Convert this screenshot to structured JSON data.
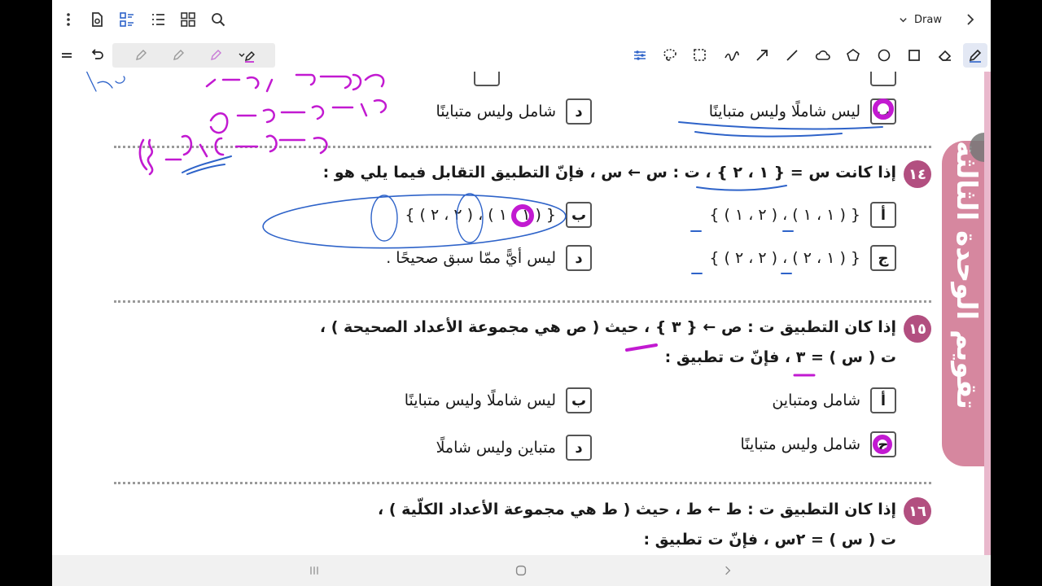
{
  "toolbar_top": {
    "mode_label": "Draw",
    "icons": [
      "more-vert-icon",
      "page-settings-icon",
      "layout-icon",
      "list-icon",
      "grid-icon",
      "search-icon",
      "chevron-down-icon",
      "chevron-right-icon"
    ]
  },
  "toolbar_draw": {
    "tools": [
      "menu-icon",
      "undo-icon",
      "pen-icon",
      "pen-icon",
      "highlighter-icon",
      "pen-active-icon",
      "settings-sliders-icon",
      "lasso-icon",
      "select-rect-icon",
      "scribble-icon",
      "arrow-icon",
      "line-icon",
      "cloud-icon",
      "pentagon-icon",
      "circle-icon",
      "square-icon",
      "eraser-icon",
      "pencil-selected-icon"
    ]
  },
  "doc": {
    "q13": {
      "opt_right": {
        "letter": "د",
        "text": "شامل وليس متباينًا"
      },
      "opt_left_partial": {
        "letter": "ب",
        "text": "ليس شاملًا وليس متباينًا"
      }
    },
    "q14": {
      "num": "١٤",
      "text": "إذا كانت س = { ١ ، ٢ } ، ت : س ← س ، فإنّ التطبيق التقابل فيما يلي هو :",
      "options": [
        {
          "letter": "أ",
          "text": "{ ( ١ ، ١ ) ، ( ٢ ، ١ ) }"
        },
        {
          "letter": "ب",
          "text": "{ ( ١ ، ١ ) ، ( ٢ ، ٢ ) }"
        },
        {
          "letter": "ج",
          "text": "{ ( ١ ، ٢ ) ، ( ٢ ، ٢ ) }"
        },
        {
          "letter": "د",
          "text": "ليس أيًّ ممّا سبق صحيحًا ."
        }
      ]
    },
    "q15": {
      "num": "١٥",
      "line1": "إذا كان التطبيق ت : ص ← { ٣ } ، حيث ( ص هي مجموعة الأعداد الصحيحة ) ،",
      "line2": "ت ( س ) = ٣ ، فإنّ ت تطبيق :",
      "options": [
        {
          "letter": "أ",
          "text": "شامل ومتباين"
        },
        {
          "letter": "ب",
          "text": "ليس شاملًا وليس متباينًا"
        },
        {
          "letter": "ج",
          "text": "شامل وليس متباينًا"
        },
        {
          "letter": "د",
          "text": "متباين وليس شاملًا"
        }
      ]
    },
    "q16": {
      "num": "١٦",
      "line1": "إذا كان التطبيق ت : ط ← ط ، حيث ( ط هي مجموعة الأعداد الكلّية ) ،",
      "line2": "ت ( س ) = ٢س ، فإنّ ت تطبيق :"
    },
    "banner_text": "تقويم الوحدة الثالثة"
  },
  "navbar": {
    "icons": [
      "recent-apps-icon",
      "home-icon",
      "back-icon"
    ]
  },
  "colors": {
    "accent": "#b24f80",
    "ink_magenta": "#c21ad1",
    "ink_blue": "#2e63c9",
    "banner": "#d6879f"
  }
}
